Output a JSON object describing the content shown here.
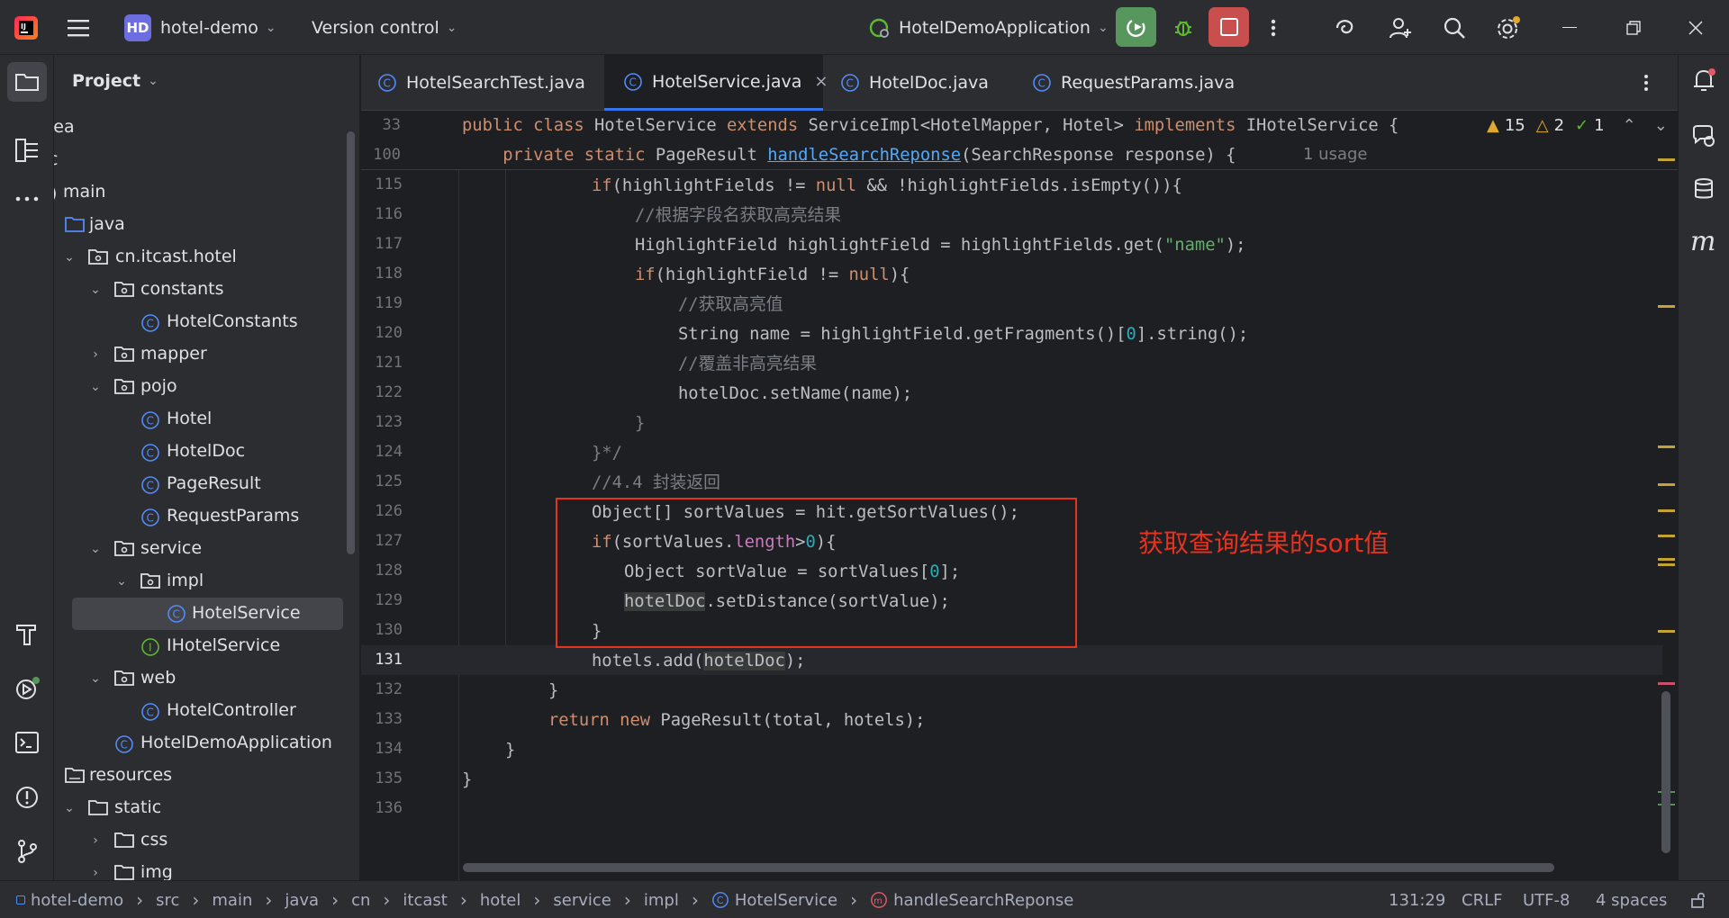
{
  "titlebar": {
    "project_badge": "HD",
    "project_name": "hotel-demo",
    "version_control": "Version control",
    "run_config": "HotelDemoApplication"
  },
  "leftbar": {
    "icons": [
      "folder-icon",
      "structure-icon",
      "more-icon",
      "build-icon",
      "services-icon",
      "terminal-icon",
      "problems-icon",
      "git-icon"
    ]
  },
  "project": {
    "title": "Project",
    "items": [
      {
        "label": "lea"
      },
      {
        "label": "c"
      },
      {
        "label": "main"
      },
      {
        "label": "java"
      },
      {
        "label": "cn.itcast.hotel"
      },
      {
        "label": "constants"
      },
      {
        "label": "HotelConstants"
      },
      {
        "label": "mapper"
      },
      {
        "label": "pojo"
      },
      {
        "label": "Hotel"
      },
      {
        "label": "HotelDoc"
      },
      {
        "label": "PageResult"
      },
      {
        "label": "RequestParams"
      },
      {
        "label": "service"
      },
      {
        "label": "impl"
      },
      {
        "label": "HotelService"
      },
      {
        "label": "IHotelService"
      },
      {
        "label": "web"
      },
      {
        "label": "HotelController"
      },
      {
        "label": "HotelDemoApplication"
      },
      {
        "label": "resources"
      },
      {
        "label": "static"
      },
      {
        "label": "css"
      },
      {
        "label": "img"
      }
    ]
  },
  "tabs": [
    {
      "label": "HotelSearchTest.java"
    },
    {
      "label": "HotelService.java",
      "active": true
    },
    {
      "label": "HotelDoc.java"
    },
    {
      "label": "RequestParams.java"
    }
  ],
  "editor": {
    "inspections": {
      "warnings": "15",
      "weak_warnings": "2",
      "ok": "1"
    },
    "usage_hint": "1 usage",
    "sticky": [
      {
        "line": "33"
      },
      {
        "line": "100"
      }
    ],
    "lines": [
      "115",
      "116",
      "117",
      "118",
      "119",
      "120",
      "121",
      "122",
      "123",
      "124",
      "125",
      "126",
      "127",
      "128",
      "129",
      "130",
      "131",
      "132",
      "133",
      "134",
      "135",
      "136"
    ],
    "annotation": "获取查询结果的sort值",
    "annotation_color": "#e8321e"
  },
  "statusbar": {
    "breadcrumb": [
      "hotel-demo",
      "src",
      "main",
      "java",
      "cn",
      "itcast",
      "hotel",
      "service",
      "impl",
      "HotelService",
      "handleSearchReponse"
    ],
    "position": "131:29",
    "line_sep": "CRLF",
    "encoding": "UTF-8",
    "indent": "4 spaces"
  },
  "colors": {
    "accent": "#3574f0",
    "run_green": "#57965c",
    "stop_red": "#c94f4f"
  }
}
